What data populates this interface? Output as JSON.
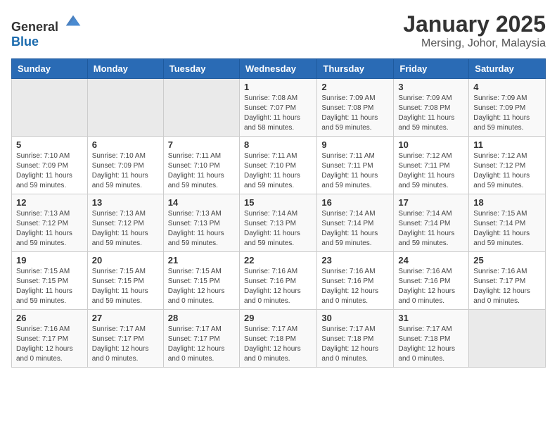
{
  "logo": {
    "general": "General",
    "blue": "Blue"
  },
  "title": "January 2025",
  "subtitle": "Mersing, Johor, Malaysia",
  "weekdays": [
    "Sunday",
    "Monday",
    "Tuesday",
    "Wednesday",
    "Thursday",
    "Friday",
    "Saturday"
  ],
  "weeks": [
    [
      {
        "day": "",
        "sunrise": "",
        "sunset": "",
        "daylight": "",
        "empty": true
      },
      {
        "day": "",
        "sunrise": "",
        "sunset": "",
        "daylight": "",
        "empty": true
      },
      {
        "day": "",
        "sunrise": "",
        "sunset": "",
        "daylight": "",
        "empty": true
      },
      {
        "day": "1",
        "sunrise": "Sunrise: 7:08 AM",
        "sunset": "Sunset: 7:07 PM",
        "daylight": "Daylight: 11 hours and 58 minutes."
      },
      {
        "day": "2",
        "sunrise": "Sunrise: 7:09 AM",
        "sunset": "Sunset: 7:08 PM",
        "daylight": "Daylight: 11 hours and 59 minutes."
      },
      {
        "day": "3",
        "sunrise": "Sunrise: 7:09 AM",
        "sunset": "Sunset: 7:08 PM",
        "daylight": "Daylight: 11 hours and 59 minutes."
      },
      {
        "day": "4",
        "sunrise": "Sunrise: 7:09 AM",
        "sunset": "Sunset: 7:09 PM",
        "daylight": "Daylight: 11 hours and 59 minutes."
      }
    ],
    [
      {
        "day": "5",
        "sunrise": "Sunrise: 7:10 AM",
        "sunset": "Sunset: 7:09 PM",
        "daylight": "Daylight: 11 hours and 59 minutes."
      },
      {
        "day": "6",
        "sunrise": "Sunrise: 7:10 AM",
        "sunset": "Sunset: 7:09 PM",
        "daylight": "Daylight: 11 hours and 59 minutes."
      },
      {
        "day": "7",
        "sunrise": "Sunrise: 7:11 AM",
        "sunset": "Sunset: 7:10 PM",
        "daylight": "Daylight: 11 hours and 59 minutes."
      },
      {
        "day": "8",
        "sunrise": "Sunrise: 7:11 AM",
        "sunset": "Sunset: 7:10 PM",
        "daylight": "Daylight: 11 hours and 59 minutes."
      },
      {
        "day": "9",
        "sunrise": "Sunrise: 7:11 AM",
        "sunset": "Sunset: 7:11 PM",
        "daylight": "Daylight: 11 hours and 59 minutes."
      },
      {
        "day": "10",
        "sunrise": "Sunrise: 7:12 AM",
        "sunset": "Sunset: 7:11 PM",
        "daylight": "Daylight: 11 hours and 59 minutes."
      },
      {
        "day": "11",
        "sunrise": "Sunrise: 7:12 AM",
        "sunset": "Sunset: 7:12 PM",
        "daylight": "Daylight: 11 hours and 59 minutes."
      }
    ],
    [
      {
        "day": "12",
        "sunrise": "Sunrise: 7:13 AM",
        "sunset": "Sunset: 7:12 PM",
        "daylight": "Daylight: 11 hours and 59 minutes."
      },
      {
        "day": "13",
        "sunrise": "Sunrise: 7:13 AM",
        "sunset": "Sunset: 7:12 PM",
        "daylight": "Daylight: 11 hours and 59 minutes."
      },
      {
        "day": "14",
        "sunrise": "Sunrise: 7:13 AM",
        "sunset": "Sunset: 7:13 PM",
        "daylight": "Daylight: 11 hours and 59 minutes."
      },
      {
        "day": "15",
        "sunrise": "Sunrise: 7:14 AM",
        "sunset": "Sunset: 7:13 PM",
        "daylight": "Daylight: 11 hours and 59 minutes."
      },
      {
        "day": "16",
        "sunrise": "Sunrise: 7:14 AM",
        "sunset": "Sunset: 7:14 PM",
        "daylight": "Daylight: 11 hours and 59 minutes."
      },
      {
        "day": "17",
        "sunrise": "Sunrise: 7:14 AM",
        "sunset": "Sunset: 7:14 PM",
        "daylight": "Daylight: 11 hours and 59 minutes."
      },
      {
        "day": "18",
        "sunrise": "Sunrise: 7:15 AM",
        "sunset": "Sunset: 7:14 PM",
        "daylight": "Daylight: 11 hours and 59 minutes."
      }
    ],
    [
      {
        "day": "19",
        "sunrise": "Sunrise: 7:15 AM",
        "sunset": "Sunset: 7:15 PM",
        "daylight": "Daylight: 11 hours and 59 minutes."
      },
      {
        "day": "20",
        "sunrise": "Sunrise: 7:15 AM",
        "sunset": "Sunset: 7:15 PM",
        "daylight": "Daylight: 11 hours and 59 minutes."
      },
      {
        "day": "21",
        "sunrise": "Sunrise: 7:15 AM",
        "sunset": "Sunset: 7:15 PM",
        "daylight": "Daylight: 12 hours and 0 minutes."
      },
      {
        "day": "22",
        "sunrise": "Sunrise: 7:16 AM",
        "sunset": "Sunset: 7:16 PM",
        "daylight": "Daylight: 12 hours and 0 minutes."
      },
      {
        "day": "23",
        "sunrise": "Sunrise: 7:16 AM",
        "sunset": "Sunset: 7:16 PM",
        "daylight": "Daylight: 12 hours and 0 minutes."
      },
      {
        "day": "24",
        "sunrise": "Sunrise: 7:16 AM",
        "sunset": "Sunset: 7:16 PM",
        "daylight": "Daylight: 12 hours and 0 minutes."
      },
      {
        "day": "25",
        "sunrise": "Sunrise: 7:16 AM",
        "sunset": "Sunset: 7:17 PM",
        "daylight": "Daylight: 12 hours and 0 minutes."
      }
    ],
    [
      {
        "day": "26",
        "sunrise": "Sunrise: 7:16 AM",
        "sunset": "Sunset: 7:17 PM",
        "daylight": "Daylight: 12 hours and 0 minutes."
      },
      {
        "day": "27",
        "sunrise": "Sunrise: 7:17 AM",
        "sunset": "Sunset: 7:17 PM",
        "daylight": "Daylight: 12 hours and 0 minutes."
      },
      {
        "day": "28",
        "sunrise": "Sunrise: 7:17 AM",
        "sunset": "Sunset: 7:17 PM",
        "daylight": "Daylight: 12 hours and 0 minutes."
      },
      {
        "day": "29",
        "sunrise": "Sunrise: 7:17 AM",
        "sunset": "Sunset: 7:18 PM",
        "daylight": "Daylight: 12 hours and 0 minutes."
      },
      {
        "day": "30",
        "sunrise": "Sunrise: 7:17 AM",
        "sunset": "Sunset: 7:18 PM",
        "daylight": "Daylight: 12 hours and 0 minutes."
      },
      {
        "day": "31",
        "sunrise": "Sunrise: 7:17 AM",
        "sunset": "Sunset: 7:18 PM",
        "daylight": "Daylight: 12 hours and 0 minutes."
      },
      {
        "day": "",
        "sunrise": "",
        "sunset": "",
        "daylight": "",
        "empty": true
      }
    ]
  ]
}
